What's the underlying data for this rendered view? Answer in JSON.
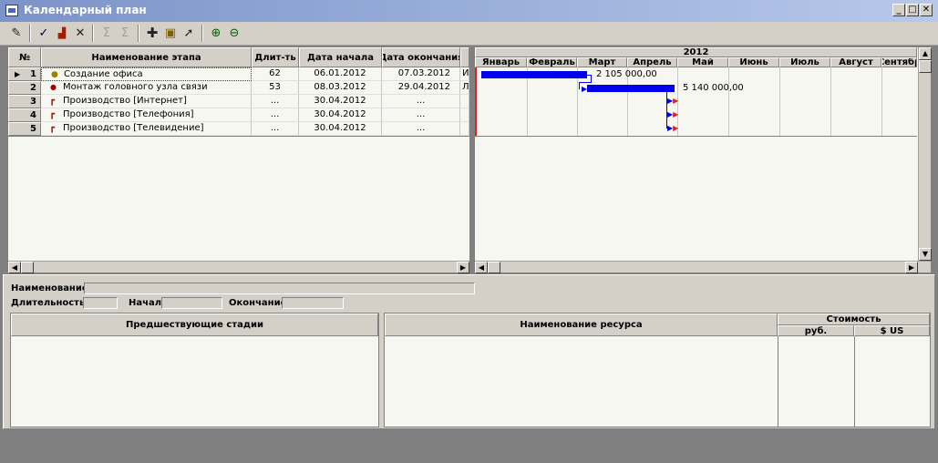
{
  "window": {
    "title": "Календарный план",
    "minimize": "_",
    "maximize": "□",
    "close": "✕"
  },
  "toolbar": {
    "icons": [
      "edit-icon",
      "check-icon",
      "budget-icon",
      "delete-icon",
      "sum-icon",
      "sum-alt-icon",
      "add-icon",
      "link-icon",
      "pointer-icon",
      "zoom-in-icon",
      "zoom-out-icon"
    ]
  },
  "grid": {
    "headers": {
      "num": "№",
      "name": "Наименование этапа",
      "duration": "Длит-ть",
      "start": "Дата начала",
      "end": "Дата окончания"
    },
    "rows": [
      {
        "num": "1",
        "name": "Создание офиса",
        "duration": "62",
        "start": "06.01.2012",
        "end": "07.03.2012",
        "extra": "И"
      },
      {
        "num": "2",
        "name": "Монтаж головного узла связи",
        "duration": "53",
        "start": "08.03.2012",
        "end": "29.04.2012",
        "extra": "Л"
      },
      {
        "num": "3",
        "name": "Производство [Интернет]",
        "duration": "...",
        "start": "30.04.2012",
        "end": "...",
        "extra": ""
      },
      {
        "num": "4",
        "name": "Производство [Телефония]",
        "duration": "...",
        "start": "30.04.2012",
        "end": "...",
        "extra": ""
      },
      {
        "num": "5",
        "name": "Производство [Телевидение]",
        "duration": "...",
        "start": "30.04.2012",
        "end": "...",
        "extra": ""
      }
    ]
  },
  "gantt": {
    "year": "2012",
    "months": [
      "Январь",
      "Февраль",
      "Март",
      "Апрель",
      "Май",
      "Июнь",
      "Июль",
      "Август",
      "Сентябр"
    ],
    "labels": {
      "bar1": "2 105 000,00",
      "bar2": "5 140 000,00"
    }
  },
  "details": {
    "name_label": "Наименование:",
    "duration_label": "Длительность:",
    "start_label": "Начало:",
    "end_label": "Окончание:",
    "pred_header": "Предшествующие стадии",
    "resource_header": "Наименование ресурса",
    "cost_header": "Стоимость",
    "rub_header": "руб.",
    "usd_header": "$ US"
  }
}
